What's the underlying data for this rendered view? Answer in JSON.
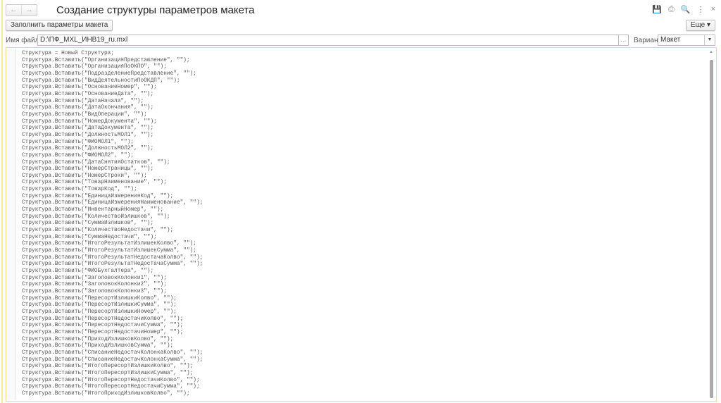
{
  "window": {
    "title": "Создание структуры параметров макета",
    "nav_back": "←",
    "nav_forward": "→",
    "icons": [
      "save-icon",
      "print-icon",
      "preview-icon",
      "more-icon",
      "close-icon"
    ],
    "icon_glyphs": [
      "💾",
      "⎙",
      "🔍",
      "⋮",
      "×"
    ]
  },
  "toolbar": {
    "fill_button": "Заполнить параметры макета",
    "more_button": "Еще ▾"
  },
  "form": {
    "file_label": "Имя файла:",
    "file_value": "D:\\ПФ_MXL_ИНВ19_ru.mxl",
    "browse": "...",
    "variant_label": "Вариант:",
    "variant_value": "Макет"
  },
  "code": {
    "lines": [
      "Структура = Новый Структура;",
      "Структура.Вставить(\"ОрганизацияПредставление\", \"\");",
      "Структура.Вставить(\"ОрганизацияПоОКПО\", \"\");",
      "Структура.Вставить(\"ПодразделениеПредставление\", \"\");",
      "Структура.Вставить(\"ВидДеятельностиПоОКДП\", \"\");",
      "Структура.Вставить(\"ОснованиеНомер\", \"\");",
      "Структура.Вставить(\"ОснованиеДата\", \"\");",
      "Структура.Вставить(\"ДатаНачала\", \"\");",
      "Структура.Вставить(\"ДатаОкончания\", \"\");",
      "Структура.Вставить(\"ВидОперации\", \"\");",
      "Структура.Вставить(\"НомерДокумента\", \"\");",
      "Структура.Вставить(\"ДатаДокумента\", \"\");",
      "Структура.Вставить(\"ДолжностьМОЛ1\", \"\");",
      "Структура.Вставить(\"ФИОМОЛ1\", \"\");",
      "Структура.Вставить(\"ДолжностьМОЛ2\", \"\");",
      "Структура.Вставить(\"ФИОМОЛ2\", \"\");",
      "Структура.Вставить(\"ДатаСнятияОстатков\", \"\");",
      "Структура.Вставить(\"НомерСтраницы\", \"\");",
      "Структура.Вставить(\"НомерСтроки\", \"\");",
      "Структура.Вставить(\"ТоварНаименование\", \"\");",
      "Структура.Вставить(\"ТоварКод\", \"\");",
      "Структура.Вставить(\"ЕдиницаИзмеренияКод\", \"\");",
      "Структура.Вставить(\"ЕдиницаИзмеренияНаименование\", \"\");",
      "Структура.Вставить(\"ИнвентарныйНомер\", \"\");",
      "Структура.Вставить(\"КоличествоИзлишков\", \"\");",
      "Структура.Вставить(\"СуммаИзлишков\", \"\");",
      "Структура.Вставить(\"КоличествоНедостачи\", \"\");",
      "Структура.Вставить(\"СуммаНедостачи\", \"\");",
      "Структура.Вставить(\"ИтогоРезультатИзлишекКолво\", \"\");",
      "Структура.Вставить(\"ИтогоРезультатИзлишекСумма\", \"\");",
      "Структура.Вставить(\"ИтогоРезультатНедостачаКолво\", \"\");",
      "Структура.Вставить(\"ИтогоРезультатНедостачаСумма\", \"\");",
      "Структура.Вставить(\"ФИОБухгалтера\", \"\");",
      "Структура.Вставить(\"ЗаголовокКолонки1\", \"\");",
      "Структура.Вставить(\"ЗаголовокКолонки2\", \"\");",
      "Структура.Вставить(\"ЗаголовокКолонки3\", \"\");",
      "Структура.Вставить(\"ПересортИзлишкиКолво\", \"\");",
      "Структура.Вставить(\"ПересортИзлишкиСумма\", \"\");",
      "Структура.Вставить(\"ПересортИзлишкиНомер\", \"\");",
      "Структура.Вставить(\"ПересортНедостачиКолво\", \"\");",
      "Структура.Вставить(\"ПересортНедостачиСумма\", \"\");",
      "Структура.Вставить(\"ПересортНедостачиНомер\", \"\");",
      "Структура.Вставить(\"ПриходИзлишковКолво\", \"\");",
      "Структура.Вставить(\"ПриходИзлишковСумма\", \"\");",
      "Структура.Вставить(\"СписаниеНедостачКолонкаКолво\", \"\");",
      "Структура.Вставить(\"СписаниеНедостачКолонкаСумма\", \"\");",
      "Структура.Вставить(\"ИтогоПересортИзлишкиКолво\", \"\");",
      "Структура.Вставить(\"ИтогоПересортИзлишкиСумма\", \"\");",
      "Структура.Вставить(\"ИтогоПересортНедостачиКолво\", \"\");",
      "Структура.Вставить(\"ИтогоПересортНедостачиСумма\", \"\");",
      "Структура.Вставить(\"ИтогоПриходИзлишковКолво\", \"\");"
    ]
  }
}
